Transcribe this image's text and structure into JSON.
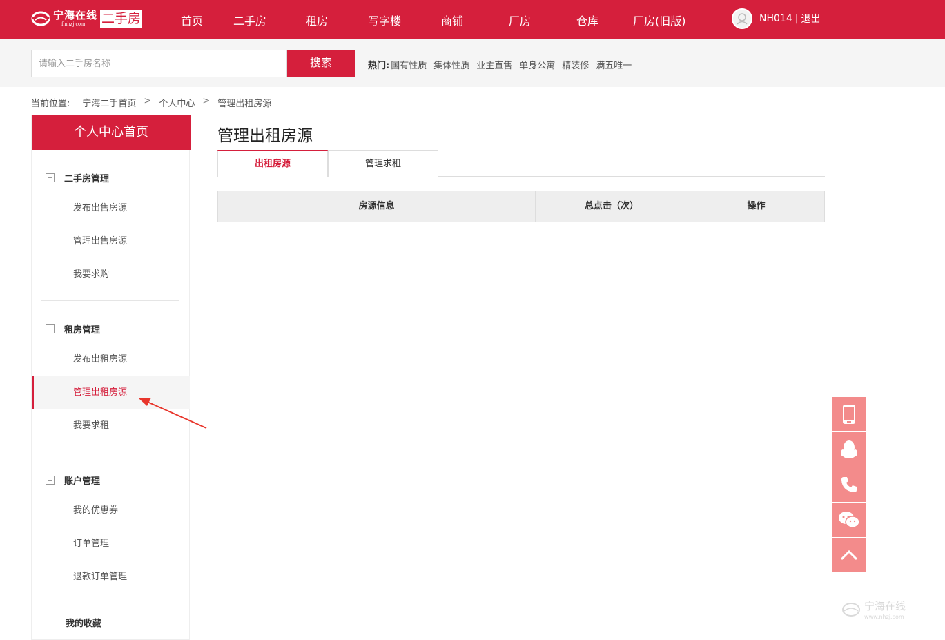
{
  "header": {
    "logo_text": "宁海在线",
    "logo_url": "f.nhzj.com",
    "logo_tag": "二手房",
    "nav": [
      "首页",
      "二手房",
      "租房",
      "写字楼",
      "商铺",
      "厂房",
      "仓库",
      "厂房(旧版)"
    ],
    "username": "NH014",
    "separator": "|",
    "logout": "退出",
    "brand_color": "#d51f3c"
  },
  "search": {
    "placeholder": "请输入二手房名称",
    "button": "搜索",
    "hot_label": "热门:",
    "hot_tags": [
      "国有性质",
      "集体性质",
      "业主直售",
      "单身公寓",
      "精装修",
      "满五唯一"
    ]
  },
  "breadcrumb": {
    "label": "当前位置:",
    "items": [
      "宁海二手首页",
      "个人中心",
      "管理出租房源"
    ],
    "arrow": ">"
  },
  "sidebar": {
    "home": "个人中心首页",
    "groups": [
      {
        "title": "二手房管理",
        "links": [
          "发布出售房源",
          "管理出售房源",
          "我要求购"
        ]
      },
      {
        "title": "租房管理",
        "links": [
          "发布出租房源",
          "管理出租房源",
          "我要求租"
        ]
      },
      {
        "title": "账户管理",
        "links": [
          "我的优惠券",
          "订单管理",
          "退款订单管理"
        ]
      }
    ],
    "favorites": "我的收藏",
    "active_link": "管理出租房源"
  },
  "main": {
    "title": "管理出租房源",
    "tabs": [
      "出租房源",
      "管理求租"
    ],
    "active_tab": "出租房源",
    "columns": [
      "房源信息",
      "总点击（次）",
      "操作"
    ]
  },
  "float_bar": {
    "icons": [
      "mobile-icon",
      "qq-icon",
      "phone-icon",
      "wechat-icon",
      "back-to-top-icon"
    ],
    "color": "#f38b8b"
  },
  "watermark": {
    "text": "宁海在线",
    "url": "www.nhzj.com"
  }
}
